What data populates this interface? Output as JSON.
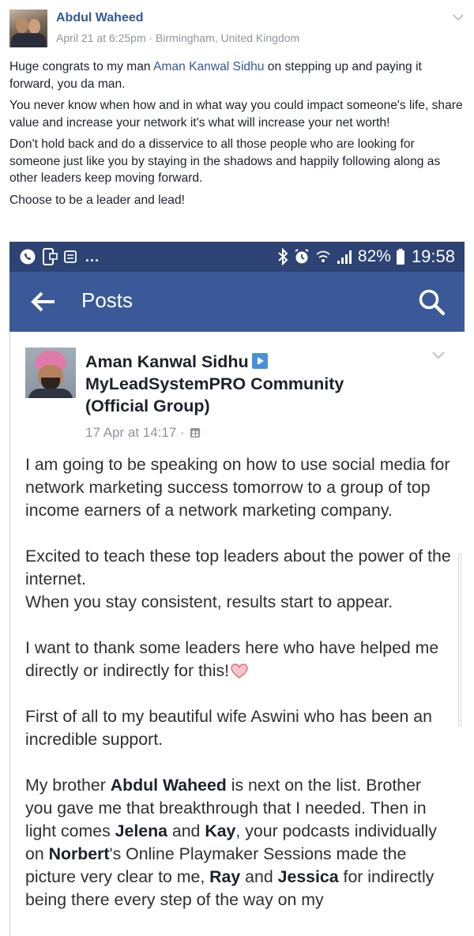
{
  "outer_post": {
    "author": "Abdul Waheed",
    "meta": "April 21 at 6:25pm · Birmingham, United Kingdom",
    "paragraph1": {
      "before": "Huge congrats to my man ",
      "mention": "Aman Kanwal Sidhu",
      "after": " on stepping up and paying it forward, you da man."
    },
    "paragraph2": "You never know when how and in what way you could impact someone's life, share value and increase your network it's what will increase your net worth!",
    "paragraph3": "Don't hold back and do a disservice to all those people who are looking for someone just like you by staying in the shadows and happily following along as other leaders keep moving forward.",
    "paragraph4": "Choose to be a leader and lead!"
  },
  "phone": {
    "status_bar": {
      "dots": "...",
      "battery": "82%",
      "time": "19:58"
    },
    "app_bar": {
      "title": "Posts"
    },
    "inner_post": {
      "author": "Aman Kanwal Sidhu",
      "group_line1": "MyLeadSystemPRO Community",
      "group_line2": "(Official Group)",
      "meta": "17 Apr at 14:17 ·",
      "p1": "I am going to be speaking on how to use social media for network marketing success tomorrow to a group of top income earners of a network marketing company.",
      "p2_line1": "Excited to teach these top leaders about the power of the internet.",
      "p2_line2": "When you stay consistent, results start to appear.",
      "p3": "I want to thank some leaders here who have helped me directly or indirectly for this!",
      "p4": "First of all to my beautiful wife Aswini who has been an incredible support.",
      "p5": {
        "t1": "My brother ",
        "b1": "Abdul Waheed",
        "t2": " is next on the list. Brother you gave me that breakthrough that I needed. Then in light comes ",
        "b2": "Jelena",
        "t3": " and ",
        "b3": "Kay",
        "t4": ", your podcasts individually on ",
        "b4": "Norbert",
        "t5": "'s Online Playmaker Sessions made the picture very clear to me, ",
        "b5": "Ray",
        "t6": " and ",
        "b6": "Jessica",
        "t7": " for indirectly being there every step of the way on my"
      }
    }
  },
  "colors": {
    "facebook_blue": "#3b5998",
    "status_bar": "#2d4373",
    "link": "#365899",
    "meta_gray": "#90949c"
  },
  "icons": [
    "chevron-down-icon",
    "whatsapp-icon",
    "phone-message-icon",
    "notes-icon",
    "bluetooth-icon",
    "alarm-icon",
    "wifi-icon",
    "signal-icon",
    "battery-icon",
    "back-arrow-icon",
    "search-icon",
    "video-icon",
    "group-icon",
    "heart-icon"
  ]
}
